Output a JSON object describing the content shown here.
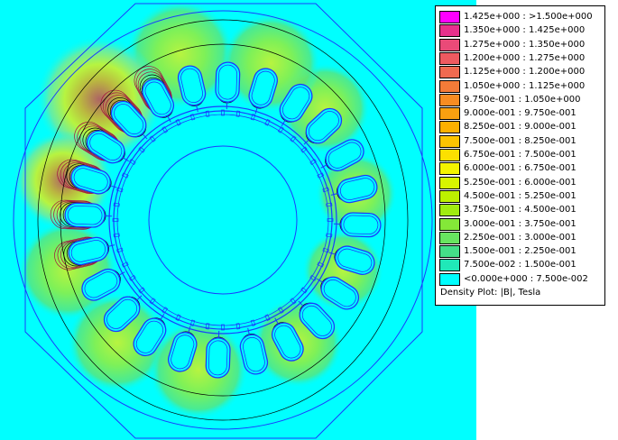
{
  "window": {
    "background_color": "#00ffff"
  },
  "legend": {
    "caption": "Density Plot: |B|, Tesla",
    "entries": [
      {
        "label": "1.425e+000 : >1.500e+000",
        "color": "#ff00ff"
      },
      {
        "label": "1.350e+000 : 1.425e+000",
        "color": "#e8308c"
      },
      {
        "label": "1.275e+000 : 1.350e+000",
        "color": "#ea4a78"
      },
      {
        "label": "1.200e+000 : 1.275e+000",
        "color": "#ee5a60"
      },
      {
        "label": "1.125e+000 : 1.200e+000",
        "color": "#f06a50"
      },
      {
        "label": "1.050e+000 : 1.125e+000",
        "color": "#f47b38"
      },
      {
        "label": "9.750e-001 : 1.050e+000",
        "color": "#f88c22"
      },
      {
        "label": "9.000e-001 : 9.750e-001",
        "color": "#faa010"
      },
      {
        "label": "8.250e-001 : 9.000e-001",
        "color": "#fcb000"
      },
      {
        "label": "7.500e-001 : 8.250e-001",
        "color": "#fcc400"
      },
      {
        "label": "6.750e-001 : 7.500e-001",
        "color": "#fce000"
      },
      {
        "label": "6.000e-001 : 6.750e-001",
        "color": "#f4f400"
      },
      {
        "label": "5.250e-001 : 6.000e-001",
        "color": "#d8f400"
      },
      {
        "label": "4.500e-001 : 5.250e-001",
        "color": "#bcf000"
      },
      {
        "label": "3.750e-001 : 4.500e-001",
        "color": "#a0ec10"
      },
      {
        "label": "3.000e-001 : 3.750e-001",
        "color": "#84e838"
      },
      {
        "label": "2.250e-001 : 3.000e-001",
        "color": "#68e460"
      },
      {
        "label": "1.500e-001 : 2.250e-001",
        "color": "#44e088"
      },
      {
        "label": "7.500e-002 : 1.500e-001",
        "color": "#20e8b8"
      },
      {
        "label": "<0.000e+000 : 7.500e-002",
        "color": "#00ffff"
      }
    ]
  },
  "plot": {
    "stator_slots": 24,
    "high_field_color": "#e84040",
    "mid_field_color": "#f4e000",
    "low_field_color": "#7ee890",
    "outline_color": "#1a3cff",
    "contour_color": "#000000"
  }
}
